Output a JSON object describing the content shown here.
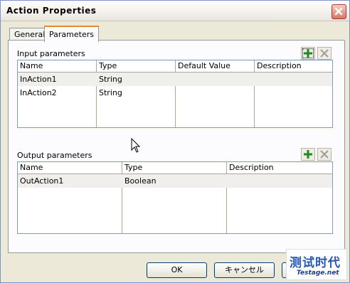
{
  "window": {
    "title": "Action Properties"
  },
  "tabs": [
    {
      "label": "General",
      "active": false
    },
    {
      "label": "Parameters",
      "active": true
    }
  ],
  "input_params": {
    "label": "Input parameters",
    "columns": [
      "Name",
      "Type",
      "Default Value",
      "Description"
    ],
    "rows": [
      [
        "InAction1",
        "String",
        "",
        ""
      ],
      [
        "InAction2",
        "String",
        "",
        ""
      ]
    ]
  },
  "output_params": {
    "label": "Output parameters",
    "columns": [
      "Name",
      "Type",
      "Description"
    ],
    "rows": [
      [
        "OutAction1",
        "Boolean",
        ""
      ]
    ]
  },
  "buttons": {
    "ok": "OK",
    "cancel": "キャンセル"
  },
  "watermark": {
    "text": "测试时代",
    "sub": "Testage.net"
  },
  "icons": [
    "close-icon",
    "add-icon",
    "delete-icon",
    "arrow-cursor-icon"
  ],
  "colors": {
    "add": "#1f8a1f",
    "delete_disabled": "#a0a0a0",
    "close_bg": "#d6785f"
  }
}
